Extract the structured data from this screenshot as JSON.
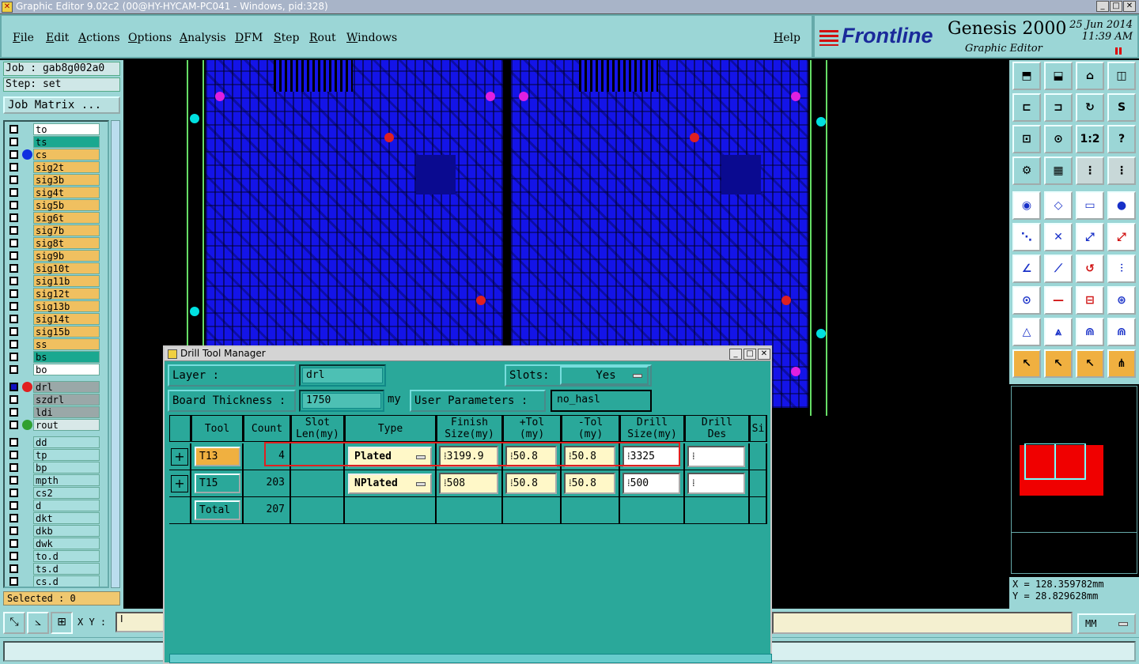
{
  "window": {
    "title": "Graphic Editor 9.02c2 (00@HY-HYCAM-PC041 - Windows, pid:328)"
  },
  "menu": {
    "items": [
      "File",
      "Edit",
      "Actions",
      "Options",
      "Analysis",
      "DFM",
      "Step",
      "Rout",
      "Windows"
    ],
    "help": "Help"
  },
  "header": {
    "brand": "Frontline",
    "product": "Genesis 2000",
    "subtitle": "Graphic Editor",
    "date": "25 Jun 2014",
    "time": "11:39 AM"
  },
  "left_panel": {
    "job": "Job : gab8g002a0",
    "step": "Step: set",
    "job_matrix": "Job Matrix ...",
    "selected": "Selected : 0",
    "layers": [
      {
        "name": "to",
        "color": "#ffffff",
        "dot": ""
      },
      {
        "name": "ts",
        "color": "#1aa890",
        "dot": ""
      },
      {
        "name": "cs",
        "color": "#f0c060",
        "dot": "#1030e0"
      },
      {
        "name": "sig2t",
        "color": "#f0c060",
        "dot": ""
      },
      {
        "name": "sig3b",
        "color": "#f0c060",
        "dot": ""
      },
      {
        "name": "sig4t",
        "color": "#f0c060",
        "dot": ""
      },
      {
        "name": "sig5b",
        "color": "#f0c060",
        "dot": ""
      },
      {
        "name": "sig6t",
        "color": "#f0c060",
        "dot": ""
      },
      {
        "name": "sig7b",
        "color": "#f0c060",
        "dot": ""
      },
      {
        "name": "sig8t",
        "color": "#f0c060",
        "dot": ""
      },
      {
        "name": "sig9b",
        "color": "#f0c060",
        "dot": ""
      },
      {
        "name": "sig10t",
        "color": "#f0c060",
        "dot": ""
      },
      {
        "name": "sig11b",
        "color": "#f0c060",
        "dot": ""
      },
      {
        "name": "sig12t",
        "color": "#f0c060",
        "dot": ""
      },
      {
        "name": "sig13b",
        "color": "#f0c060",
        "dot": ""
      },
      {
        "name": "sig14t",
        "color": "#f0c060",
        "dot": ""
      },
      {
        "name": "sig15b",
        "color": "#f0c060",
        "dot": ""
      },
      {
        "name": "ss",
        "color": "#f0c060",
        "dot": ""
      },
      {
        "name": "bs",
        "color": "#1aa890",
        "dot": ""
      },
      {
        "name": "bo",
        "color": "#ffffff",
        "dot": ""
      },
      {
        "name": "drl",
        "color": "#9aa8a8",
        "dot": "#e02020"
      },
      {
        "name": "szdrl",
        "color": "#9aa8a8",
        "dot": ""
      },
      {
        "name": "ldi",
        "color": "#9aa8a8",
        "dot": ""
      },
      {
        "name": "rout",
        "color": "#d8e8e8",
        "dot": "#30a030"
      },
      {
        "name": "dd",
        "color": "#a8dede",
        "dot": ""
      },
      {
        "name": "tp",
        "color": "#a8dede",
        "dot": ""
      },
      {
        "name": "bp",
        "color": "#a8dede",
        "dot": ""
      },
      {
        "name": "mpth",
        "color": "#a8dede",
        "dot": ""
      },
      {
        "name": "cs2",
        "color": "#a8dede",
        "dot": ""
      },
      {
        "name": "d",
        "color": "#a8dede",
        "dot": ""
      },
      {
        "name": "dkt",
        "color": "#a8dede",
        "dot": ""
      },
      {
        "name": "dkb",
        "color": "#a8dede",
        "dot": ""
      },
      {
        "name": "dwk",
        "color": "#a8dede",
        "dot": ""
      },
      {
        "name": "to.d",
        "color": "#a8dede",
        "dot": ""
      },
      {
        "name": "ts.d",
        "color": "#a8dede",
        "dot": ""
      },
      {
        "name": "cs.d",
        "color": "#a8dede",
        "dot": ""
      }
    ]
  },
  "coords": {
    "x": "X = 128.359782mm",
    "y": "Y = 28.829628mm"
  },
  "bottom": {
    "xy_label": "X Y :",
    "units": "MM"
  },
  "dialog": {
    "title": "Drill Tool Manager",
    "layer_label": "Layer            :",
    "layer_value": "drl",
    "slots_label": "Slots:",
    "slots_value": "Yes",
    "thickness_label": "Board Thickness :",
    "thickness_value": "1750",
    "thickness_unit": "my",
    "user_params_label": "User Parameters :",
    "user_params_value": "no_hasl",
    "columns": [
      "Tool",
      "Count",
      "Slot\nLen(my)",
      "Type",
      "Finish\nSize(my)",
      "+Tol\n(my)",
      "-Tol\n(my)",
      "Drill\nSize(my)",
      "Drill\nDes",
      "Si"
    ],
    "rows": [
      {
        "tool": "T13",
        "count": "4",
        "slot_len": "",
        "type": "Plated",
        "finish": "3199.9",
        "ptol": "50.8",
        "ntol": "50.8",
        "drill": "3325",
        "des": ""
      },
      {
        "tool": "T15",
        "count": "203",
        "slot_len": "",
        "type": "NPlated",
        "finish": "508",
        "ptol": "50.8",
        "ntol": "50.8",
        "drill": "500",
        "des": ""
      }
    ],
    "total_label": "Total",
    "total_count": "207"
  }
}
